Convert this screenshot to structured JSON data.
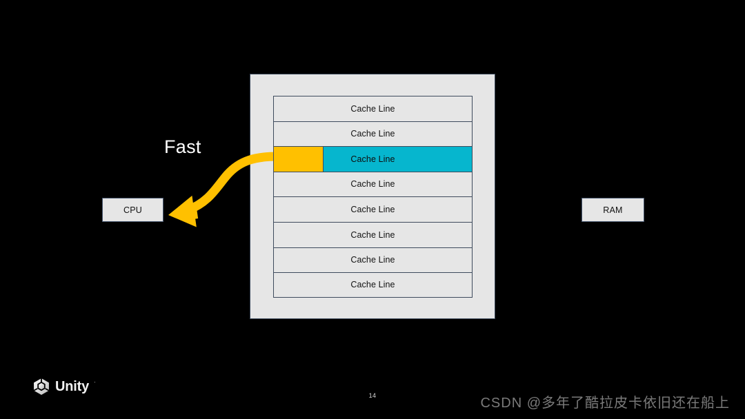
{
  "slide": {
    "page_number": "14",
    "background_color": "#000000"
  },
  "labels": {
    "fast": "Fast"
  },
  "units": {
    "cpu": "CPU",
    "ram": "RAM"
  },
  "cache": {
    "rows": [
      {
        "label": "Cache Line",
        "highlighted": false
      },
      {
        "label": "Cache Line",
        "highlighted": false
      },
      {
        "label": "Cache Line",
        "highlighted": true
      },
      {
        "label": "Cache Line",
        "highlighted": false
      },
      {
        "label": "Cache Line",
        "highlighted": false
      },
      {
        "label": "Cache Line",
        "highlighted": false
      },
      {
        "label": "Cache Line",
        "highlighted": false
      },
      {
        "label": "Cache Line",
        "highlighted": false
      }
    ]
  },
  "colors": {
    "highlight_cyan": "#06b6ce",
    "segment_yellow": "#ffc000",
    "arrow_yellow": "#ffc000",
    "panel_gray": "#e6e6e6",
    "border_blue_gray": "#3d4a5c"
  },
  "branding": {
    "unity_wordmark": "Unity",
    "unity_trademark": "·"
  },
  "watermark": {
    "text": "CSDN @多年了酷拉皮卡依旧还在船上"
  }
}
